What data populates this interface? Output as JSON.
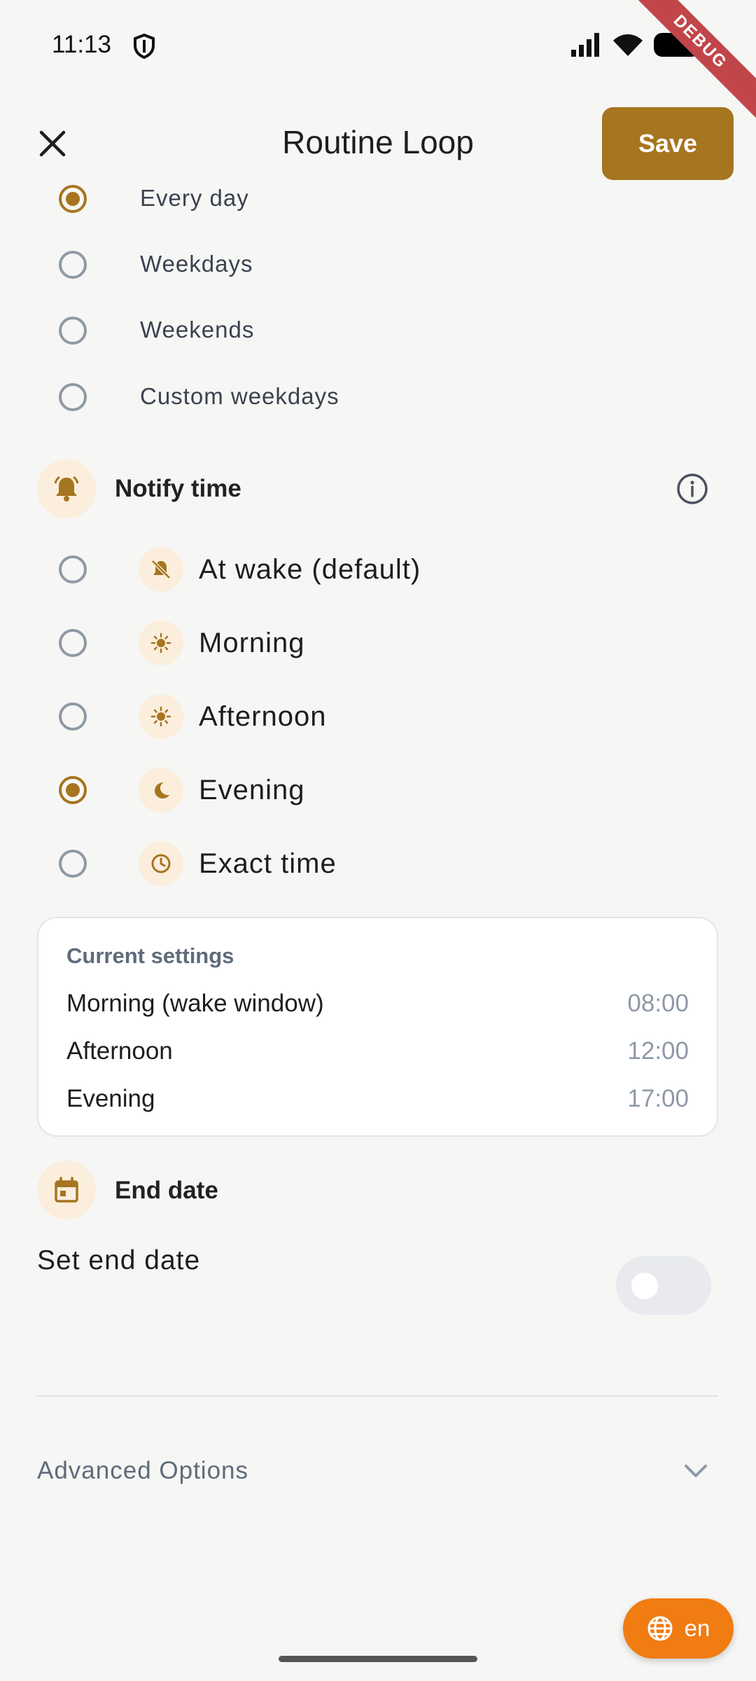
{
  "status_bar": {
    "time": "11:13",
    "debug_label": "DEBUG"
  },
  "app_bar": {
    "title": "Routine Loop",
    "save_label": "Save"
  },
  "repeat_options": [
    {
      "label": "Every day",
      "selected": true
    },
    {
      "label": "Weekdays",
      "selected": false
    },
    {
      "label": "Weekends",
      "selected": false
    },
    {
      "label": "Custom weekdays",
      "selected": false
    }
  ],
  "notify": {
    "title": "Notify time",
    "options": [
      {
        "label": "At wake (default)",
        "icon": "bell-off-icon",
        "selected": false
      },
      {
        "label": "Morning",
        "icon": "sun-icon",
        "selected": false
      },
      {
        "label": "Afternoon",
        "icon": "sun-icon",
        "selected": false
      },
      {
        "label": "Evening",
        "icon": "moon-icon",
        "selected": true
      },
      {
        "label": "Exact time",
        "icon": "clock-icon",
        "selected": false
      }
    ]
  },
  "current_settings": {
    "title": "Current settings",
    "rows": [
      {
        "label": "Morning (wake window)",
        "value": "08:00"
      },
      {
        "label": "Afternoon",
        "value": "12:00"
      },
      {
        "label": "Evening",
        "value": "17:00"
      }
    ]
  },
  "end_date": {
    "title": "End date",
    "toggle_label": "Set end date",
    "enabled": false
  },
  "advanced": {
    "label": "Advanced Options"
  },
  "language": {
    "code": "en"
  },
  "colors": {
    "accent": "#a6751f",
    "accent_soft": "#fbeedd",
    "fab": "#f07c12"
  }
}
